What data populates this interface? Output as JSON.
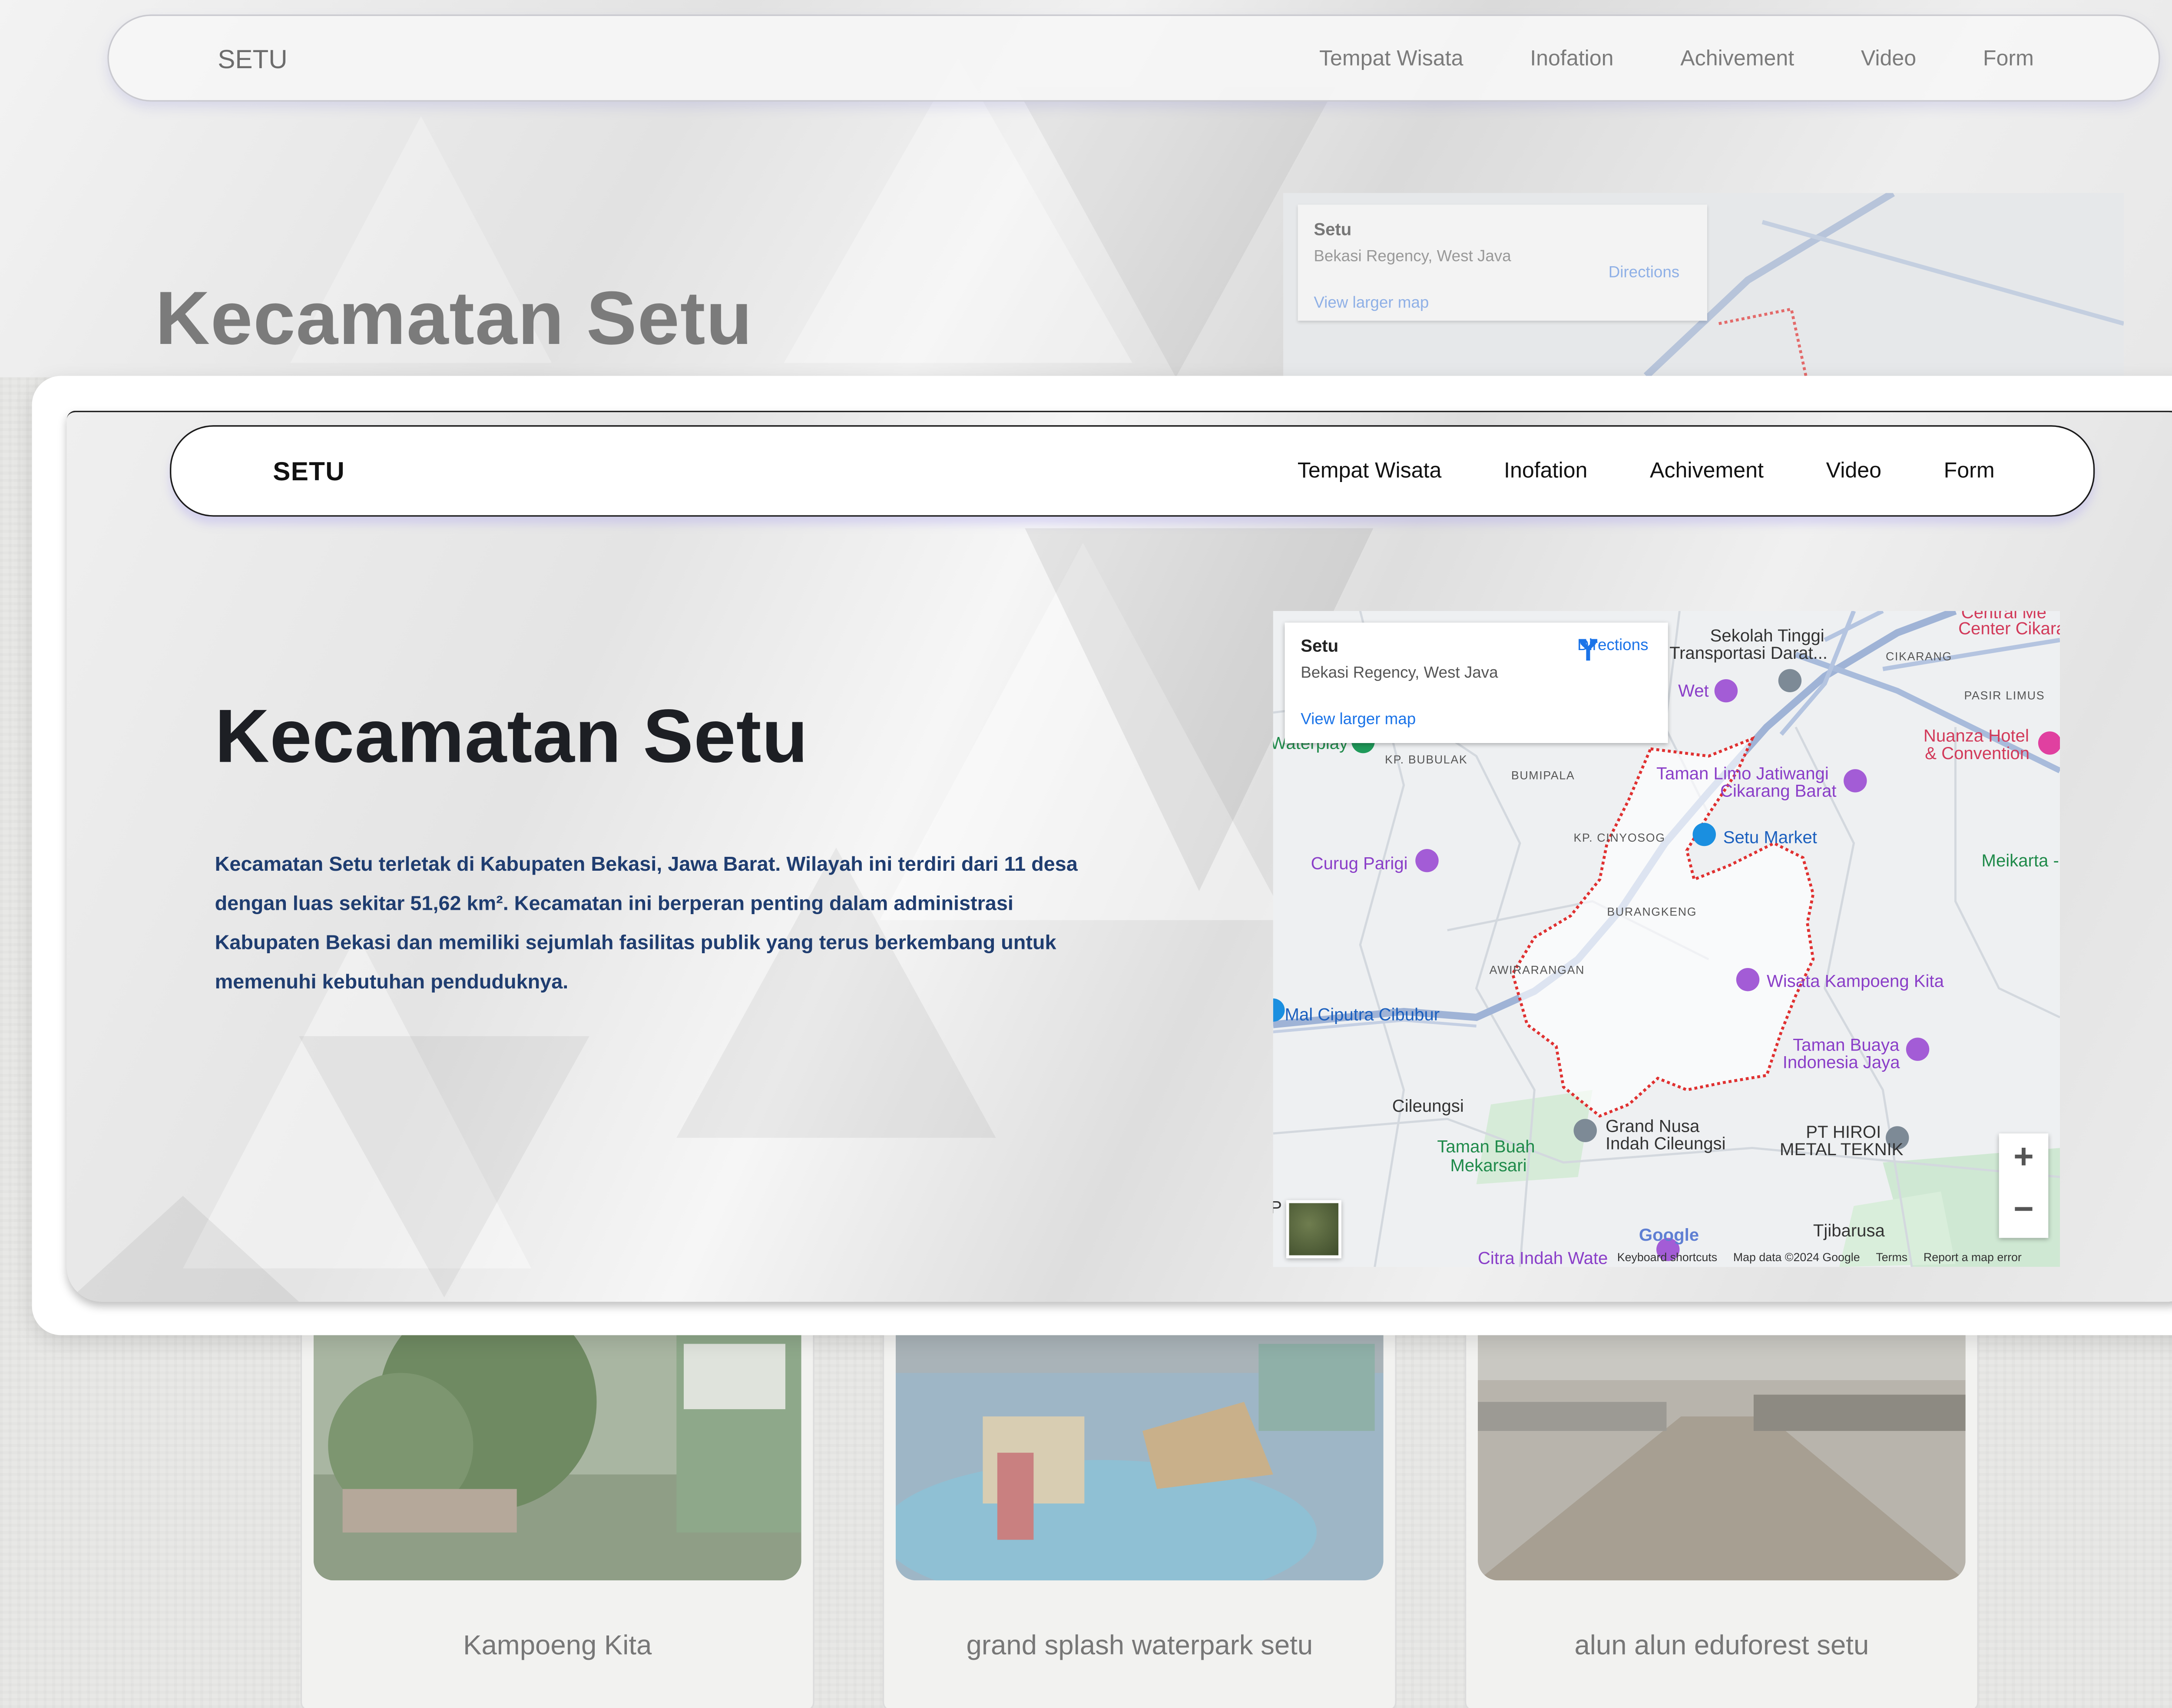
{
  "site": {
    "logo": "SETU",
    "nav": [
      "Tempat Wisata",
      "Inofation",
      "Achivement",
      "Video",
      "Form"
    ]
  },
  "hero": {
    "title": "Kecamatan Setu",
    "description": "Kecamatan Setu terletak di Kabupaten Bekasi, Jawa Barat. Wilayah ini terdiri dari 11 desa dengan luas sekitar 51,62 km². Kecamatan ini berperan penting dalam administrasi Kabupaten Bekasi dan memiliki sejumlah fasilitas publik yang terus berkembang untuk memenuhi kebutuhan penduduknya."
  },
  "map": {
    "place_name": "Setu",
    "place_address": "Bekasi Regency, West Java",
    "directions_label": "Directions",
    "larger_map_label": "View larger map",
    "zoom_in": "+",
    "zoom_out": "−",
    "google": "Google",
    "attribution": [
      "Keyboard shortcuts",
      "Map data ©2024 Google",
      "Terms",
      "Report a map error"
    ],
    "labels": {
      "sekolah": "Sekolah Tinggi",
      "sekolah2": "Transportasi Darat...",
      "central": "Central Me",
      "center": "Center Cikara",
      "cikarang": "CIKARANG",
      "pasir": "PASIR LIMUS",
      "wet": "Wet",
      "nuanza": "Nuanza Hotel",
      "convention": "& Convention",
      "waterplay": "Waterplay",
      "bubulak": "KP. BUBULAK",
      "bumipala": "BUMIPALA",
      "taman_limo": "Taman Limo Jatiwangi",
      "cikarang_barat": "Cikarang Barat",
      "cinyosog": "KP. CINYOSOG",
      "setu_market": "Setu Market",
      "meikarta": "Meikarta -",
      "curug": "Curug Parigi",
      "burangkeng": "BURANGKENG",
      "awirarangan": "AWIRARANGAN",
      "kampoeng": "Wisata Kampoeng Kita",
      "mal": "Mal Ciputra Cibubur",
      "taman_buaya": "Taman Buaya",
      "indonesia_jaya": "Indonesia Jaya",
      "cileungsi": "Cileungsi",
      "grand_nusa": "Grand Nusa",
      "indah": "Indah Cileungsi",
      "hiroi": "PT HIROI",
      "metal": "METAL TEKNIK",
      "taman_buah": "Taman Buah",
      "mekarsari": "Mekarsari",
      "tjibarusa": "Tjibarusa",
      "citra": "Citra Indah Wate",
      "p": "P"
    }
  },
  "cards": [
    "Kampoeng Kita",
    "grand splash waterpark setu",
    "alun alun eduforest setu"
  ],
  "colors": {
    "title": "#1d1f24",
    "description": "#1f3d70",
    "link_blue": "#1a73e8",
    "boundary_red": "#e03030",
    "poi_purple": "#8a3ec8"
  }
}
